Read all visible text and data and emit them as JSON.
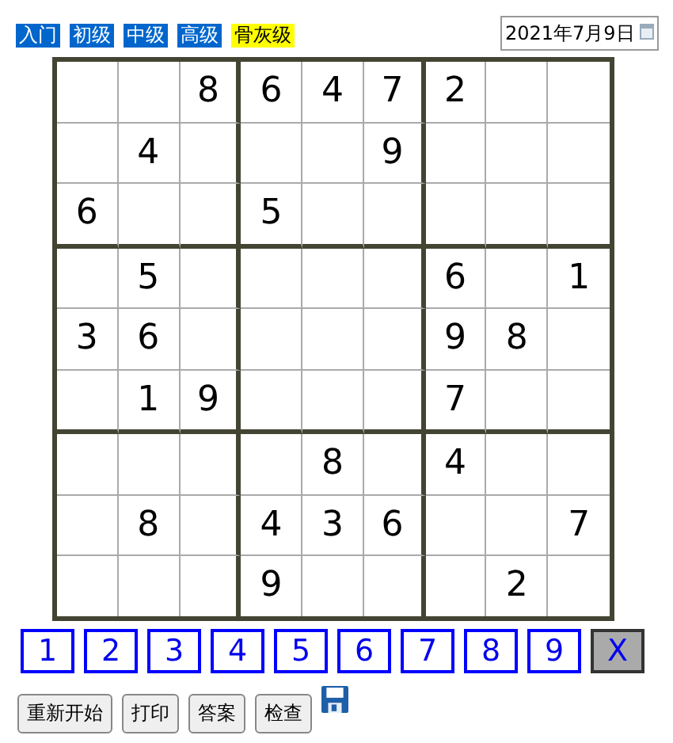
{
  "levels": [
    {
      "label": "入门",
      "selected": false
    },
    {
      "label": "初级",
      "selected": false
    },
    {
      "label": "中级",
      "selected": false
    },
    {
      "label": "高级",
      "selected": false
    },
    {
      "label": "骨灰级",
      "selected": true
    }
  ],
  "date": {
    "value": "2021年7月9日"
  },
  "grid": [
    [
      {
        "kind": "blank"
      },
      {
        "kind": "blank"
      },
      {
        "kind": "given",
        "value": "8"
      },
      {
        "kind": "given",
        "value": "6"
      },
      {
        "kind": "given",
        "value": "4"
      },
      {
        "kind": "given",
        "value": "7"
      },
      {
        "kind": "given",
        "value": "2"
      },
      {
        "kind": "blank"
      },
      {
        "kind": "blank"
      }
    ],
    [
      {
        "kind": "blank"
      },
      {
        "kind": "given",
        "value": "4"
      },
      {
        "kind": "blank"
      },
      {
        "kind": "blank"
      },
      {
        "kind": "blank"
      },
      {
        "kind": "given",
        "value": "9"
      },
      {
        "kind": "blank"
      },
      {
        "kind": "blank"
      },
      {
        "kind": "blank"
      }
    ],
    [
      {
        "kind": "given",
        "value": "6"
      },
      {
        "kind": "blank"
      },
      {
        "kind": "blank"
      },
      {
        "kind": "given",
        "value": "5"
      },
      {
        "kind": "blank"
      },
      {
        "kind": "blank"
      },
      {
        "kind": "blank"
      },
      {
        "kind": "blank"
      },
      {
        "kind": "blank"
      }
    ],
    [
      {
        "kind": "blank"
      },
      {
        "kind": "given",
        "value": "5"
      },
      {
        "kind": "blank"
      },
      {
        "kind": "blank"
      },
      {
        "kind": "blank"
      },
      {
        "kind": "blank"
      },
      {
        "kind": "given",
        "value": "6"
      },
      {
        "kind": "blank"
      },
      {
        "kind": "given",
        "value": "1"
      }
    ],
    [
      {
        "kind": "given",
        "value": "3"
      },
      {
        "kind": "given",
        "value": "6"
      },
      {
        "kind": "blank"
      },
      {
        "kind": "blank"
      },
      {
        "kind": "blank"
      },
      {
        "kind": "blank"
      },
      {
        "kind": "given",
        "value": "9"
      },
      {
        "kind": "given",
        "value": "8"
      },
      {
        "kind": "blank"
      }
    ],
    [
      {
        "kind": "blank"
      },
      {
        "kind": "given",
        "value": "1"
      },
      {
        "kind": "given",
        "value": "9"
      },
      {
        "kind": "blank"
      },
      {
        "kind": "blank"
      },
      {
        "kind": "blank"
      },
      {
        "kind": "given",
        "value": "7"
      },
      {
        "kind": "blank"
      },
      {
        "kind": "blank"
      }
    ],
    [
      {
        "kind": "blank"
      },
      {
        "kind": "blank"
      },
      {
        "kind": "blank"
      },
      {
        "kind": "blank"
      },
      {
        "kind": "given",
        "value": "8"
      },
      {
        "kind": "blank"
      },
      {
        "kind": "given",
        "value": "4"
      },
      {
        "kind": "blank"
      },
      {
        "kind": "blank"
      }
    ],
    [
      {
        "kind": "blank"
      },
      {
        "kind": "given",
        "value": "8"
      },
      {
        "kind": "blank"
      },
      {
        "kind": "given",
        "value": "4"
      },
      {
        "kind": "given",
        "value": "3"
      },
      {
        "kind": "given",
        "value": "6"
      },
      {
        "kind": "blank"
      },
      {
        "kind": "blank"
      },
      {
        "kind": "given",
        "value": "7"
      }
    ],
    [
      {
        "kind": "blank"
      },
      {
        "kind": "blank"
      },
      {
        "kind": "blank"
      },
      {
        "kind": "given",
        "value": "9"
      },
      {
        "kind": "blank"
      },
      {
        "kind": "blank"
      },
      {
        "kind": "blank"
      },
      {
        "kind": "given",
        "value": "2"
      },
      {
        "kind": "blank"
      }
    ]
  ],
  "keypad": [
    {
      "label": "1",
      "kind": "digit"
    },
    {
      "label": "2",
      "kind": "digit"
    },
    {
      "label": "3",
      "kind": "digit"
    },
    {
      "label": "4",
      "kind": "digit"
    },
    {
      "label": "5",
      "kind": "digit"
    },
    {
      "label": "6",
      "kind": "digit"
    },
    {
      "label": "7",
      "kind": "digit"
    },
    {
      "label": "8",
      "kind": "digit"
    },
    {
      "label": "9",
      "kind": "digit"
    },
    {
      "label": "X",
      "kind": "clear"
    }
  ],
  "actions": [
    "重新开始",
    "打印",
    "答案",
    "检查"
  ]
}
